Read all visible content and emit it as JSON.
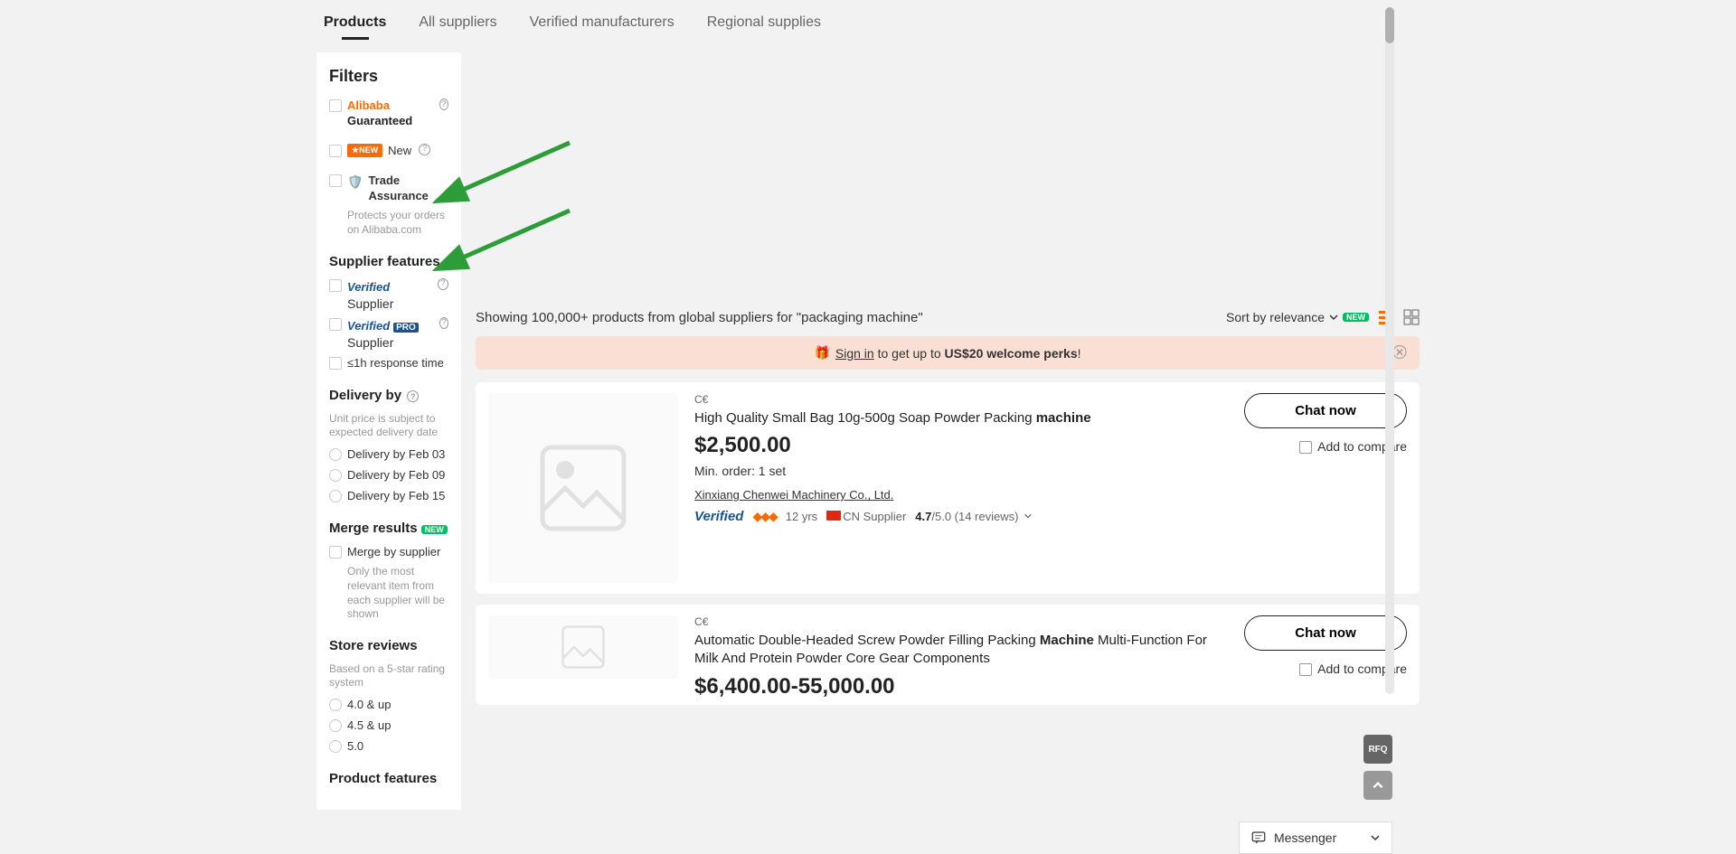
{
  "tabs": [
    "Products",
    "All suppliers",
    "Verified manufacturers",
    "Regional supplies"
  ],
  "sidebar": {
    "filters_heading": "Filters",
    "alibaba_guaranteed": {
      "a": "Alibaba",
      "b": "Guaranteed"
    },
    "new_label": "New",
    "new_badge": "★NEW",
    "trade": {
      "label": "Trade Assurance",
      "help": "Protects your orders on Alibaba.com"
    },
    "sup_feat_heading": "Supplier features",
    "verified": {
      "v": "Verified",
      "s": "Supplier"
    },
    "verified_pro": {
      "v": "Verified",
      "p": "PRO",
      "s": "Supplier"
    },
    "resp_time": "≤1h response time",
    "delivery_heading": "Delivery by",
    "delivery_help": "Unit price is subject to expected delivery date",
    "delivery_opts": [
      "Delivery by Feb 03",
      "Delivery by Feb 09",
      "Delivery by Feb 15"
    ],
    "merge_heading": "Merge results",
    "merge_new": "NEW",
    "merge_label": "Merge by supplier",
    "merge_help": "Only the most relevant item from each supplier will be shown",
    "reviews_heading": "Store reviews",
    "reviews_help": "Based on a 5-star rating system",
    "review_opts": [
      "4.0 & up",
      "4.5 & up",
      "5.0"
    ],
    "product_feat_heading": "Product features"
  },
  "results": {
    "heading": "Showing 100,000+ products from global suppliers for \"packaging machine\"",
    "sort_label": "Sort by relevance",
    "sort_new": "NEW"
  },
  "banner": {
    "signin": "Sign in",
    "mid": " to get up to ",
    "perk": "US$20 welcome perks",
    "ex": "!"
  },
  "cards": [
    {
      "cert": "C€",
      "title_a": "High Quality Small Bag 10g-500g Soap Powder Packing ",
      "title_b": "machine",
      "price": "$2,500.00",
      "moq": "Min. order: 1 set",
      "company": "Xinxiang Chenwei Machinery Co., Ltd.",
      "yrs": "12 yrs",
      "country": "CN Supplier",
      "rating": "4.7",
      "rating_sfx": "/5.0 (14 reviews)",
      "chat": "Chat now",
      "compare": "Add to compare"
    },
    {
      "cert": "C€",
      "title_a": "Automatic Double-Headed Screw Powder Filling Packing ",
      "title_b": "Machine",
      "title_c": " Multi-Function For Milk And Protein Powder Core Gear Components",
      "price": "$6,400.00-55,000.00",
      "chat": "Chat now",
      "compare": "Add to compare"
    }
  ],
  "float": {
    "rfq": "RFQ"
  },
  "messenger": "Messenger"
}
